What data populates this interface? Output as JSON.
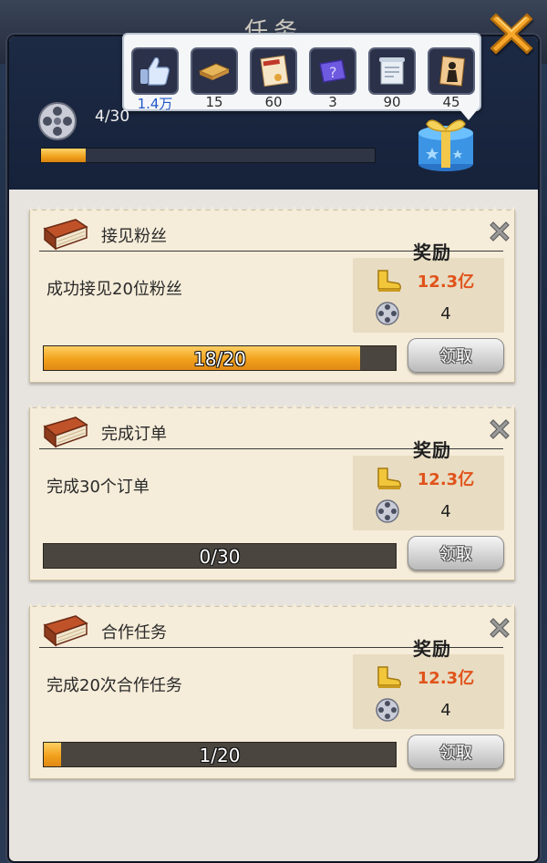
{
  "window_title": "任务",
  "resources": [
    {
      "icon": "thumbs-up-icon",
      "count": "1.4万",
      "highlight": true
    },
    {
      "icon": "wood-planks-icon",
      "count": "15",
      "highlight": false
    },
    {
      "icon": "work-permit-icon",
      "count": "60",
      "highlight": false
    },
    {
      "icon": "mystery-card-icon",
      "count": "3",
      "highlight": false
    },
    {
      "icon": "scroll-map-icon",
      "count": "90",
      "highlight": false
    },
    {
      "icon": "silhouette-card-icon",
      "count": "45",
      "highlight": false
    }
  ],
  "film_progress": {
    "label": "4/30",
    "fraction": 0.133
  },
  "reward_title": "奖励",
  "tasks": [
    {
      "title": "接见粉丝",
      "description": "成功接见20位粉丝",
      "reward_gold": "12.3亿",
      "reward_film": "4",
      "progress_text": "18/20",
      "progress_fraction": 0.9,
      "claim_label": "领取"
    },
    {
      "title": "完成订单",
      "description": "完成30个订单",
      "reward_gold": "12.3亿",
      "reward_film": "4",
      "progress_text": "0/30",
      "progress_fraction": 0.0,
      "claim_label": "领取"
    },
    {
      "title": "合作任务",
      "description": "完成20次合作任务",
      "reward_gold": "12.3亿",
      "reward_film": "4",
      "progress_text": "1/20",
      "progress_fraction": 0.05,
      "claim_label": "领取"
    }
  ],
  "colors": {
    "progress_fill": "#f0a21c",
    "reward_gold_text": "#e0531a",
    "close_orange": "#f5a623"
  }
}
